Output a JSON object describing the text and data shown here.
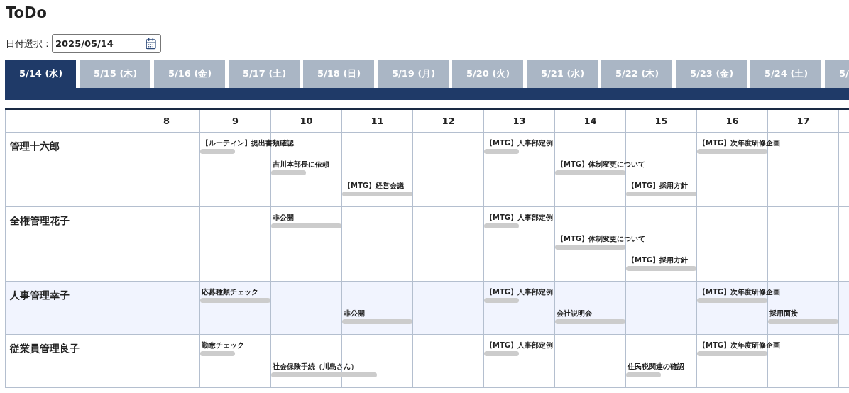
{
  "title": "ToDo",
  "date_picker": {
    "label": "日付選択：",
    "value": "2025/05/14"
  },
  "tabs": [
    {
      "label": "5/14 (水)",
      "selected": true
    },
    {
      "label": "5/15 (木)",
      "selected": false
    },
    {
      "label": "5/16 (金)",
      "selected": false
    },
    {
      "label": "5/17 (土)",
      "selected": false
    },
    {
      "label": "5/18 (日)",
      "selected": false
    },
    {
      "label": "5/19 (月)",
      "selected": false
    },
    {
      "label": "5/20 (火)",
      "selected": false
    },
    {
      "label": "5/21 (水)",
      "selected": false
    },
    {
      "label": "5/22 (木)",
      "selected": false
    },
    {
      "label": "5/23 (金)",
      "selected": false
    },
    {
      "label": "5/24 (土)",
      "selected": false
    },
    {
      "label": "5/",
      "selected": false
    }
  ],
  "schedule": {
    "hours": [
      "8",
      "9",
      "10",
      "11",
      "12",
      "13",
      "14",
      "15",
      "16",
      "17"
    ],
    "rows": [
      {
        "name": "管理十六郎",
        "highlighted": false,
        "lanes": [
          [
            {
              "kind": "free"
            },
            {
              "kind": "half",
              "title": "【ルーティン】提出書類確認"
            },
            {
              "kind": "free"
            },
            {
              "kind": "free"
            },
            {
              "kind": "free"
            },
            {
              "kind": "half",
              "title": "【MTG】人事部定例"
            },
            {
              "kind": "free"
            },
            {
              "kind": "free"
            },
            {
              "kind": "hour",
              "title": "【MTG】次年度研修企画"
            },
            {
              "kind": "free"
            }
          ],
          [
            {
              "kind": "free"
            },
            {
              "kind": "free"
            },
            {
              "kind": "half",
              "title": "吉川本部長に依頼"
            },
            {
              "kind": "free"
            },
            {
              "kind": "free"
            },
            {
              "kind": "free"
            },
            {
              "kind": "hour",
              "title": "【MTG】体制変更について"
            },
            {
              "kind": "free"
            },
            {
              "kind": "free"
            },
            {
              "kind": "free"
            }
          ],
          [
            {
              "kind": "free"
            },
            {
              "kind": "free"
            },
            {
              "kind": "free"
            },
            {
              "kind": "hour",
              "title": "【MTG】経営会議"
            },
            {
              "kind": "free"
            },
            {
              "kind": "free"
            },
            {
              "kind": "free"
            },
            {
              "kind": "hour",
              "title": "【MTG】採用方針"
            },
            {
              "kind": "free"
            },
            {
              "kind": "free"
            }
          ]
        ]
      },
      {
        "name": "全権管理花子",
        "highlighted": false,
        "lanes": [
          [
            {
              "kind": "free"
            },
            {
              "kind": "free"
            },
            {
              "kind": "hour",
              "title": "非公開"
            },
            {
              "kind": "free"
            },
            {
              "kind": "free"
            },
            {
              "kind": "half",
              "title": "【MTG】人事部定例"
            },
            {
              "kind": "free"
            },
            {
              "kind": "free"
            },
            {
              "kind": "free"
            },
            {
              "kind": "free"
            }
          ],
          [
            {
              "kind": "free"
            },
            {
              "kind": "free"
            },
            {
              "kind": "free"
            },
            {
              "kind": "free"
            },
            {
              "kind": "free"
            },
            {
              "kind": "free"
            },
            {
              "kind": "hour",
              "title": "【MTG】体制変更について"
            },
            {
              "kind": "free"
            },
            {
              "kind": "free"
            },
            {
              "kind": "free"
            }
          ],
          [
            {
              "kind": "free"
            },
            {
              "kind": "free"
            },
            {
              "kind": "free"
            },
            {
              "kind": "free"
            },
            {
              "kind": "free"
            },
            {
              "kind": "free"
            },
            {
              "kind": "free"
            },
            {
              "kind": "hour",
              "title": "【MTG】採用方針"
            },
            {
              "kind": "free"
            },
            {
              "kind": "free"
            }
          ]
        ]
      },
      {
        "name": "人事管理幸子",
        "highlighted": true,
        "lanes": [
          [
            {
              "kind": "free"
            },
            {
              "kind": "hour",
              "title": "応募種類チェック"
            },
            {
              "kind": "free"
            },
            {
              "kind": "free"
            },
            {
              "kind": "free"
            },
            {
              "kind": "half",
              "title": "【MTG】人事部定例"
            },
            {
              "kind": "free"
            },
            {
              "kind": "free"
            },
            {
              "kind": "hour",
              "title": "【MTG】次年度研修企画"
            },
            {
              "kind": "free"
            }
          ],
          [
            {
              "kind": "free"
            },
            {
              "kind": "free"
            },
            {
              "kind": "free"
            },
            {
              "kind": "hour",
              "title": "非公開"
            },
            {
              "kind": "free"
            },
            {
              "kind": "free"
            },
            {
              "kind": "hour",
              "title": "会社説明会"
            },
            {
              "kind": "free"
            },
            {
              "kind": "free"
            },
            {
              "kind": "hour",
              "title": "採用面接"
            }
          ]
        ]
      },
      {
        "name": "従業員管理良子",
        "highlighted": false,
        "lanes": [
          [
            {
              "kind": "free"
            },
            {
              "kind": "half",
              "title": "勤怠チェック"
            },
            {
              "kind": "free"
            },
            {
              "kind": "free"
            },
            {
              "kind": "free"
            },
            {
              "kind": "half",
              "title": "【MTG】人事部定例"
            },
            {
              "kind": "free"
            },
            {
              "kind": "free"
            },
            {
              "kind": "hour",
              "title": "【MTG】次年度研修企画"
            },
            {
              "kind": "free"
            }
          ],
          [
            {
              "kind": "free"
            },
            {
              "kind": "free"
            },
            {
              "kind": "long",
              "title": "社会保険手続（川島さん）"
            },
            {
              "kind": "free"
            },
            {
              "kind": "free"
            },
            {
              "kind": "free"
            },
            {
              "kind": "free"
            },
            {
              "kind": "half",
              "title": "住民税関連の確認"
            },
            {
              "kind": "free"
            },
            {
              "kind": "free"
            }
          ]
        ]
      }
    ]
  }
}
